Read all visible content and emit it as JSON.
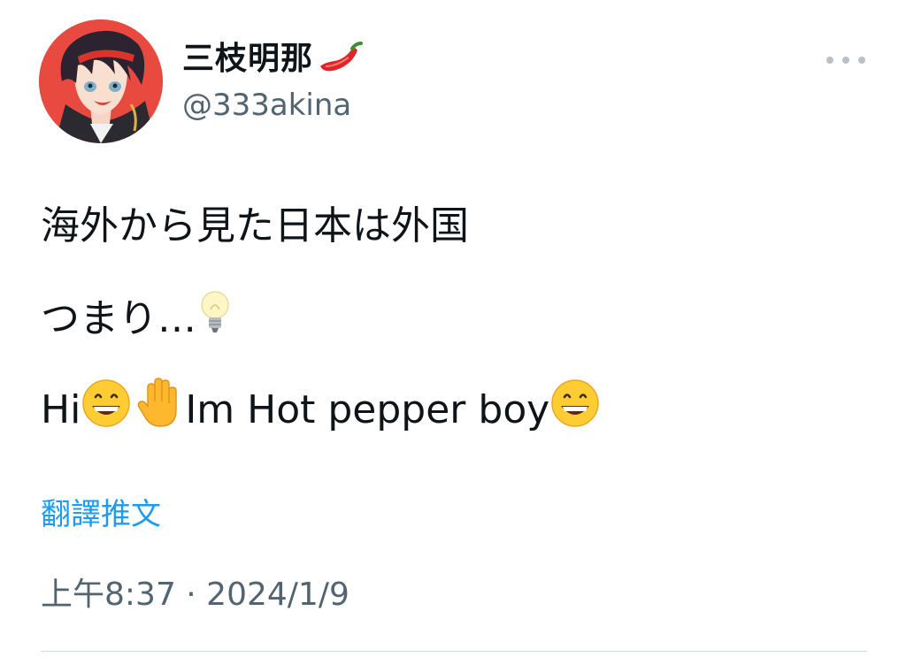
{
  "user": {
    "display_name": "三枝明那",
    "name_emoji": "chili-pepper-icon",
    "handle": "@333akina"
  },
  "tweet": {
    "line1": "海外から見た日本は外国",
    "line2_text": "つまり…",
    "line2_emoji": "light-bulb-icon",
    "line3_hi": "Hi",
    "line3_main": " Im Hot pepper boy",
    "line3_emojis": [
      "grinning-face-icon",
      "raised-hand-icon",
      "grinning-face-icon"
    ]
  },
  "translate_label": "翻譯推文",
  "timestamp": "上午8:37 · 2024/1/9",
  "colors": {
    "avatar_bg": "#e94a3f",
    "link": "#1d9bf0",
    "secondary_text": "#536471"
  }
}
